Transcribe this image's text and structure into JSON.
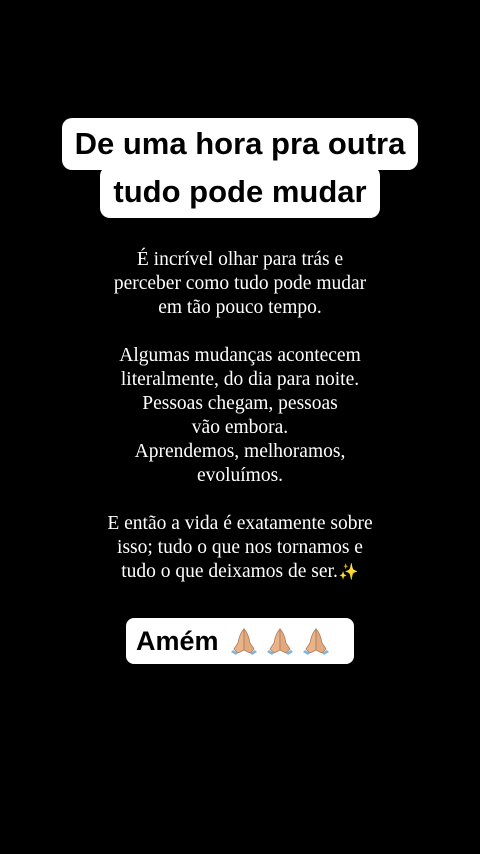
{
  "title": {
    "line1": "De uma hora pra outra",
    "line2": "tudo pode mudar"
  },
  "body": {
    "paragraph1": [
      "É incrível olhar para trás e",
      "perceber como tudo pode mudar",
      "em tão pouco tempo."
    ],
    "paragraph2": [
      "Algumas mudanças acontecem",
      "literalmente, do dia para noite.",
      "Pessoas chegam, pessoas",
      "vão embora.",
      "Aprendemos, melhoramos,",
      "evoluímos."
    ],
    "paragraph3": [
      "E então a vida é exatamente sobre",
      "isso; tudo o que nos tornamos e",
      "tudo o que deixamos de ser."
    ],
    "sparkle_icon": "sparkles-icon"
  },
  "closing": {
    "label": "Amém",
    "icons": [
      "praying-hands-icon",
      "praying-hands-icon",
      "praying-hands-icon"
    ]
  },
  "colors": {
    "background": "#000000",
    "text": "#ffffff",
    "highlight": "#ffffff",
    "sparkle": "#f5c542",
    "skin": "#e8b48a"
  }
}
